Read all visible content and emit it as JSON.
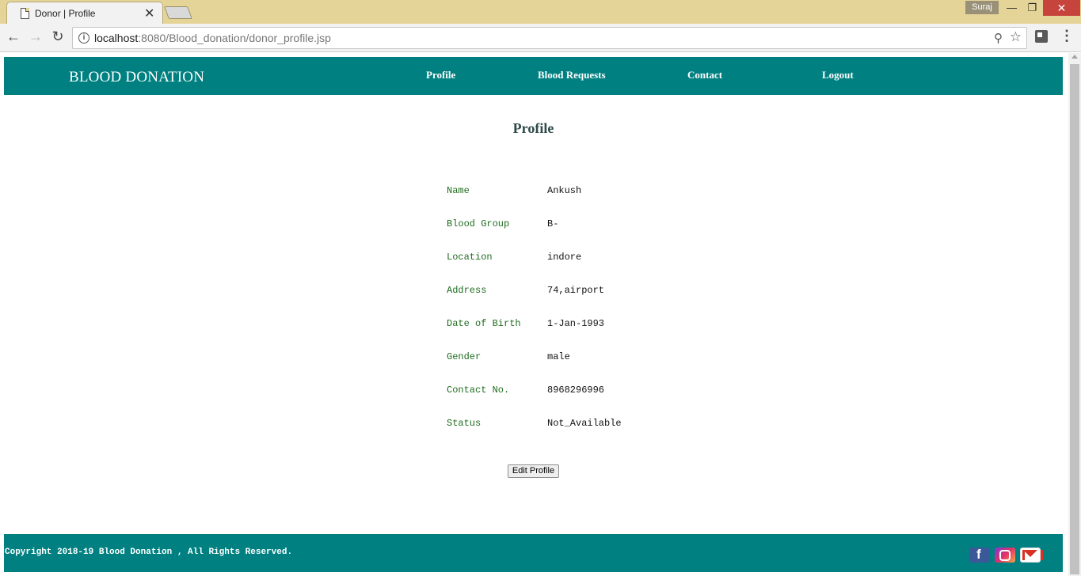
{
  "browser": {
    "tab_title": "Donor | Profile",
    "tab_close": "✕",
    "user_badge": "Suraj",
    "window_buttons": {
      "minimize": "—",
      "maximize": "❐",
      "close": "✕"
    },
    "url_host": "localhost",
    "url_rest": ":8080/Blood_donation/donor_profile.jsp",
    "icons": [
      "back-arrow-icon",
      "forward-arrow-icon",
      "reload-icon",
      "info-icon",
      "zoom-icon",
      "star-icon",
      "extension-icon",
      "menu-icon"
    ]
  },
  "header": {
    "brand": "BLOOD DONATION",
    "nav": {
      "profile": "Profile",
      "blood_requests": "Blood Requests",
      "contact": "Contact",
      "logout": "Logout"
    }
  },
  "main": {
    "heading": "Profile",
    "fields": [
      {
        "label": "Name",
        "value": "Ankush"
      },
      {
        "label": "Blood Group",
        "value": "B-"
      },
      {
        "label": "Location",
        "value": "indore"
      },
      {
        "label": "Address",
        "value": "74,airport"
      },
      {
        "label": "Date of Birth",
        "value": "1-Jan-1993"
      },
      {
        "label": "Gender",
        "value": "male"
      },
      {
        "label": "Contact No.",
        "value": "8968296996"
      },
      {
        "label": "Status",
        "value": "Not_Available"
      }
    ],
    "edit_button": "Edit Profile"
  },
  "footer": {
    "copyright": "Copyright 2018-19 Blood Donation , All Rights Reserved.",
    "social_icons": [
      "facebook-icon",
      "instagram-icon",
      "gmail-icon"
    ]
  },
  "colors": {
    "brand_teal": "#008080",
    "label_green": "#1f6d1f",
    "chrome_titlebar": "#e5d498",
    "window_close": "#c7443d"
  }
}
